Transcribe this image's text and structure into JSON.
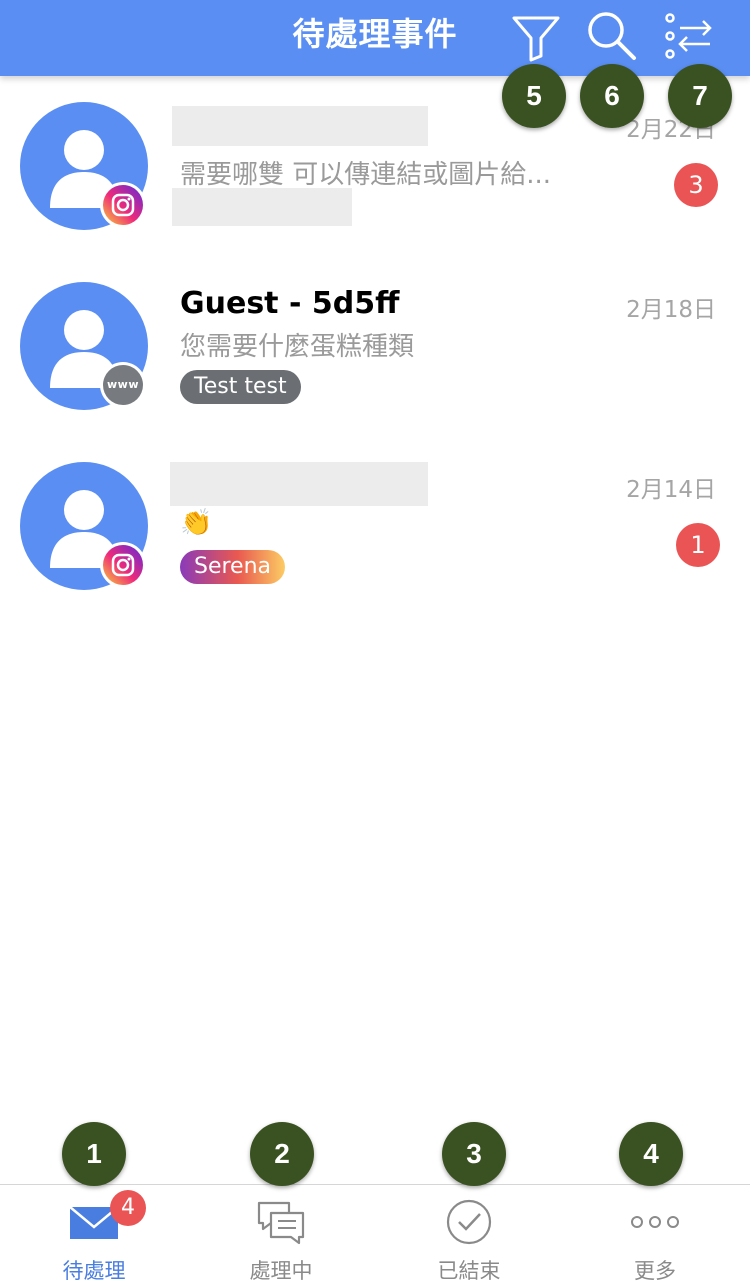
{
  "header": {
    "title": "待處理事件",
    "icons": [
      "filter-icon",
      "search-icon",
      "sort-settings-icon"
    ],
    "background_color": "#5a8ef2"
  },
  "conversations": [
    {
      "name": "",
      "name_redacted": true,
      "preview": "需要哪雙 可以傳連結或圖片給...",
      "date": "2月22日",
      "channel": "instagram",
      "unread": "3",
      "tag": ""
    },
    {
      "name": "Guest - 5d5ff",
      "preview": "您需要什麼蛋糕種類",
      "date": "2月18日",
      "channel": "website",
      "channel_label": "www",
      "unread": "",
      "tag": "Test test"
    },
    {
      "name": "",
      "name_redacted": true,
      "preview": "👏",
      "date": "2月14日",
      "channel": "instagram",
      "unread": "1",
      "tag": "Serena"
    }
  ],
  "markers": [
    "1",
    "2",
    "3",
    "4",
    "5",
    "6",
    "7"
  ],
  "tabbar": {
    "tabs": [
      {
        "label": "待處理",
        "icon": "mail-icon",
        "active": true,
        "badge": "4"
      },
      {
        "label": "處理中",
        "icon": "chat-bubbles-icon",
        "active": false
      },
      {
        "label": "已結束",
        "icon": "check-circle-icon",
        "active": false
      },
      {
        "label": "更多",
        "icon": "more-dots-icon",
        "active": false
      }
    ],
    "active_color": "#4a7de0"
  },
  "colors": {
    "unread_badge": "#ea5454",
    "avatar": "#5a8ef2",
    "marker": "#3a5222"
  }
}
